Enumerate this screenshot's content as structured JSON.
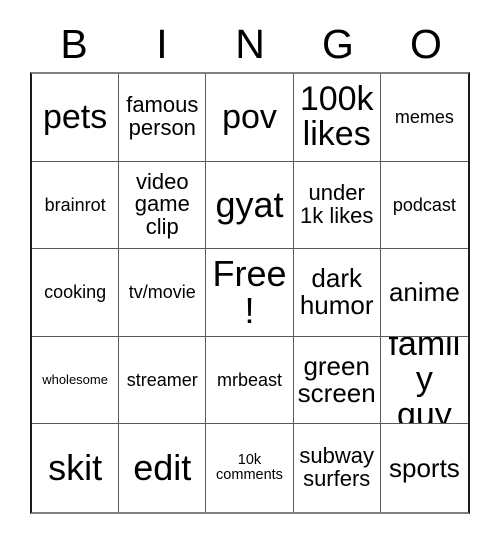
{
  "card": {
    "title": "BINGO",
    "headers": [
      "B",
      "I",
      "N",
      "G",
      "O"
    ],
    "free_space_label": "Free!",
    "free_space_position": {
      "row": 3,
      "col": 3
    },
    "grid_size": "5x5",
    "columns": {
      "B": [
        "pets",
        "brainrot",
        "cooking",
        "wholesome",
        "skit"
      ],
      "I": [
        "famous person",
        "video game clip",
        "tv/movie",
        "streamer",
        "edit"
      ],
      "N": [
        "pov",
        "gyat",
        "Free!",
        "mrbeast",
        "10k comments"
      ],
      "G": [
        "100k likes",
        "under 1k likes",
        "dark humor",
        "green screen",
        "subway surfers"
      ],
      "O": [
        "memes",
        "podcast",
        "anime",
        "family guy",
        "sports"
      ]
    },
    "rows": [
      [
        {
          "text": "pets",
          "size": "lg"
        },
        {
          "text": "famous person",
          "size": "sm"
        },
        {
          "text": "pov",
          "size": "lg"
        },
        {
          "text": "100k likes",
          "size": "lg"
        },
        {
          "text": "memes",
          "size": "xs"
        }
      ],
      [
        {
          "text": "brainrot",
          "size": "xs"
        },
        {
          "text": "video game clip",
          "size": "sm"
        },
        {
          "text": "gyat",
          "size": "xl"
        },
        {
          "text": "under 1k likes",
          "size": "sm"
        },
        {
          "text": "podcast",
          "size": "xs"
        }
      ],
      [
        {
          "text": "cooking",
          "size": "xs"
        },
        {
          "text": "tv/movie",
          "size": "xs"
        },
        {
          "text": "Free!",
          "size": "xl"
        },
        {
          "text": "dark humor",
          "size": "md"
        },
        {
          "text": "anime",
          "size": "md"
        }
      ],
      [
        {
          "text": "wholesome",
          "size": "tiny"
        },
        {
          "text": "streamer",
          "size": "xs"
        },
        {
          "text": "mrbeast",
          "size": "xs"
        },
        {
          "text": "green screen",
          "size": "md"
        },
        {
          "text": "family guy",
          "size": "lg"
        }
      ],
      [
        {
          "text": "skit",
          "size": "xl"
        },
        {
          "text": "edit",
          "size": "xl"
        },
        {
          "text": "10k comments",
          "size": "xxs"
        },
        {
          "text": "subway surfers",
          "size": "sm"
        },
        {
          "text": "sports",
          "size": "md"
        }
      ]
    ]
  },
  "colors": {
    "background": "#ffffff",
    "text": "#000000",
    "grid_line": "#5a5a5a",
    "border_outer": "#1a1a1a"
  }
}
